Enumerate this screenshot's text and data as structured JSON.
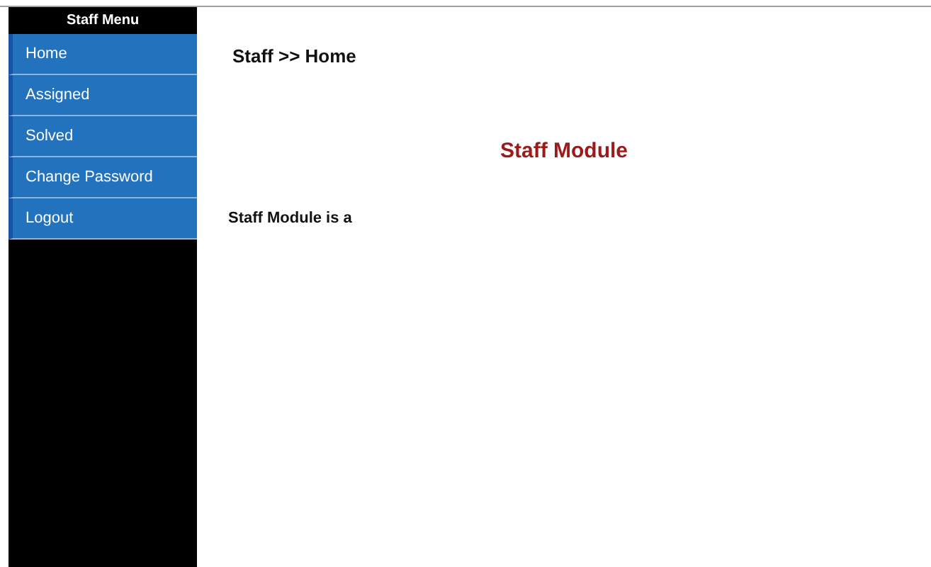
{
  "sidebar": {
    "title": "Staff Menu",
    "items": [
      {
        "label": "Home"
      },
      {
        "label": "Assigned"
      },
      {
        "label": "Solved"
      },
      {
        "label": "Change Password"
      },
      {
        "label": "Logout"
      }
    ]
  },
  "breadcrumb": "Staff >> Home",
  "heading": "Staff Module",
  "paragraph": "Staff Module is a"
}
